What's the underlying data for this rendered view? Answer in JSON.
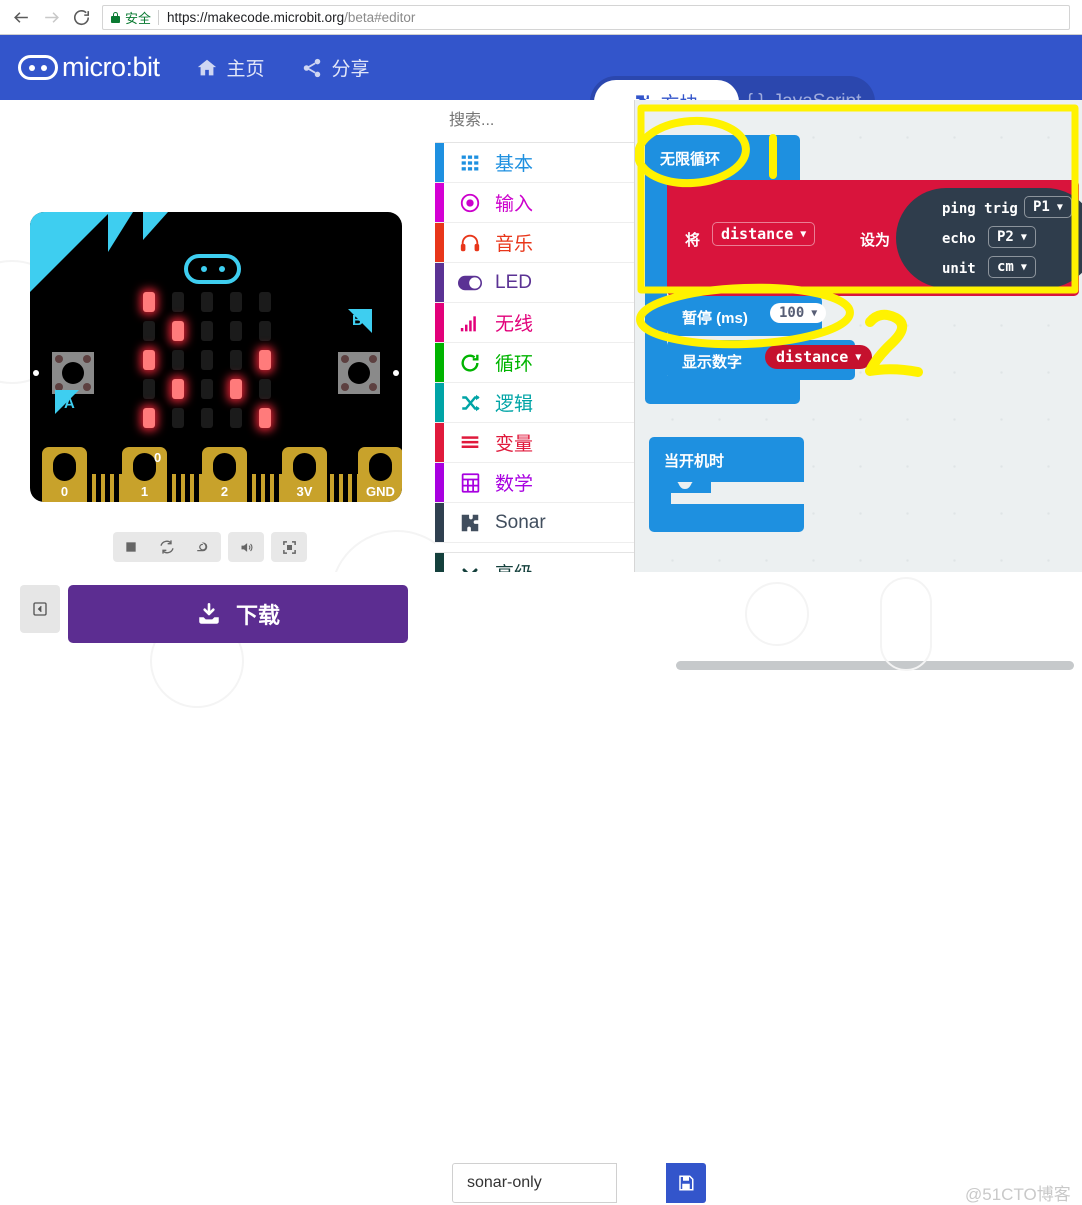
{
  "browser": {
    "back_icon": "arrow-left-icon",
    "forward_icon": "arrow-right-icon",
    "reload_icon": "reload-icon",
    "secure_label": "安全",
    "url_scheme": "https://",
    "url_host": "makecode.microbit.org",
    "url_path": "/beta#editor"
  },
  "header": {
    "brand": "micro:bit",
    "nav": [
      {
        "label": "主页",
        "icon": "home-icon"
      },
      {
        "label": "分享",
        "icon": "share-icon"
      }
    ],
    "modes": [
      {
        "label": "方块",
        "icon": "puzzle-icon",
        "active": true
      },
      {
        "label": "JavaScript",
        "icon": "braces-icon",
        "active": false
      }
    ]
  },
  "simulator": {
    "board_label_a": "A",
    "board_label_b": "B",
    "pin_zero_overlay": "0",
    "pins": [
      "0",
      "1",
      "2",
      "3V",
      "GND"
    ],
    "led_matrix": [
      [
        1,
        0,
        0,
        0,
        0
      ],
      [
        0,
        1,
        0,
        0,
        0
      ],
      [
        1,
        0,
        0,
        0,
        1
      ],
      [
        0,
        1,
        0,
        1,
        0
      ],
      [
        1,
        0,
        0,
        0,
        1
      ]
    ],
    "led_on_color": "#ff7b7b",
    "accent_color": "#3ECEF0",
    "controls": [
      {
        "name": "stop-button",
        "icon": "stop-icon"
      },
      {
        "name": "restart-button",
        "icon": "restart-icon"
      },
      {
        "name": "slow-motion-button",
        "icon": "snail-icon"
      },
      {
        "name": "mute-button",
        "icon": "volume-icon"
      },
      {
        "name": "fullscreen-button",
        "icon": "fullscreen-icon"
      }
    ]
  },
  "toolbox": {
    "search_placeholder": "搜索...",
    "search_icon": "search-icon",
    "categories": [
      {
        "label": "基本",
        "color": "#1E90E0",
        "text_color": "#1E90E0",
        "icon": "grid-icon"
      },
      {
        "label": "输入",
        "color": "#D400D4",
        "text_color": "#CC00CC",
        "icon": "target-icon"
      },
      {
        "label": "音乐",
        "color": "#E8361A",
        "text_color": "#E8361A",
        "icon": "headphones-icon"
      },
      {
        "label": "LED",
        "color": "#5B3294",
        "text_color": "#5B3294",
        "icon": "toggle-icon"
      },
      {
        "label": "无线",
        "color": "#E2007A",
        "text_color": "#E2007A",
        "icon": "signal-icon"
      },
      {
        "label": "循环",
        "color": "#00B400",
        "text_color": "#00B400",
        "icon": "refresh-icon"
      },
      {
        "label": "逻辑",
        "color": "#00A4A6",
        "text_color": "#00A4A6",
        "icon": "shuffle-icon"
      },
      {
        "label": "变量",
        "color": "#E01A3C",
        "text_color": "#E01A3C",
        "icon": "lines-icon"
      },
      {
        "label": "数学",
        "color": "#A800E0",
        "text_color": "#A800E0",
        "icon": "calculator-icon"
      },
      {
        "label": "Sonar",
        "color": "#2F4050",
        "text_color": "#414E5E",
        "icon": "extension-icon"
      }
    ],
    "advanced": {
      "label": "高级",
      "color": "#14403C",
      "text_color": "#14403C",
      "icon": "chevron-down-icon"
    },
    "scroll_up_icon": "caret-up-icon",
    "scroll_down_icon": "caret-down-icon"
  },
  "workspace": {
    "forever_block": {
      "label": "无限循环",
      "color": "#1E90E0"
    },
    "set_block": {
      "prefix": "将",
      "variable": "distance",
      "suffix": "设为",
      "color": "#D9143C"
    },
    "sonar_block": {
      "color": "#2F3D4C",
      "rows": [
        {
          "label": "ping trig",
          "value": "P1"
        },
        {
          "label": "echo",
          "value": "P2"
        },
        {
          "label": "unit",
          "value": "cm"
        }
      ]
    },
    "pause_block": {
      "label": "暂停 (ms)",
      "value": "100",
      "color": "#1E90E0"
    },
    "show_number_block": {
      "label": "显示数字",
      "value": "distance",
      "color": "#1E90E0",
      "value_color": "#C5112E"
    },
    "on_start_block": {
      "label": "当开机时",
      "color": "#1E90E0"
    },
    "annotations": [
      {
        "name": "annotation-rect",
        "shape": "rectangle",
        "color": "#FFF200"
      },
      {
        "name": "annotation-circle-forever",
        "shape": "circle",
        "color": "#FFF200"
      },
      {
        "name": "annotation-number-1",
        "shape": "text",
        "text": "1",
        "color": "#FFF200"
      },
      {
        "name": "annotation-circle-pause",
        "shape": "circle",
        "color": "#FFF200"
      },
      {
        "name": "annotation-number-2",
        "shape": "text",
        "text": "2",
        "color": "#FFF200"
      }
    ]
  },
  "bottom": {
    "collapse_icon": "collapse-left-icon",
    "download_label": "下载",
    "download_icon": "download-icon",
    "filename_value": "sonar-only",
    "save_icon": "save-icon",
    "watermark": "@51CTO博客"
  }
}
